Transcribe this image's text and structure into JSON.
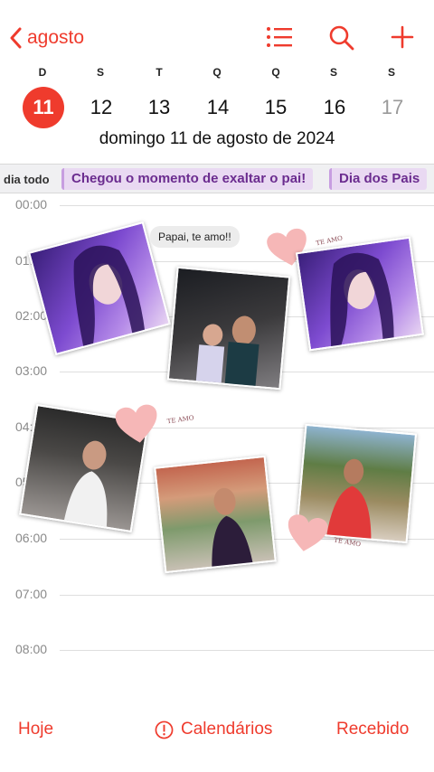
{
  "colors": {
    "accent": "#ef3b2d",
    "event_bg": "#e9d9f2",
    "event_text": "#6b2c8f"
  },
  "header": {
    "back_label": "agosto",
    "icons": [
      "chevron-left-icon",
      "list-icon",
      "search-icon",
      "plus-icon"
    ]
  },
  "week": {
    "weekdays": [
      "D",
      "S",
      "T",
      "Q",
      "Q",
      "S",
      "S"
    ],
    "days": [
      "11",
      "12",
      "13",
      "14",
      "15",
      "16",
      "17"
    ],
    "selected_index": 0,
    "date_title": "domingo  11 de agosto de 2024"
  },
  "allday": {
    "label": "dia todo",
    "events": [
      "Chegou o momento de exaltar o pai!",
      "Dia dos Pais"
    ]
  },
  "timeline": {
    "hours": [
      "00:00",
      "01:00",
      "02:00",
      "03:00",
      "04:00",
      "05:00",
      "06:00",
      "07:00",
      "08:00"
    ]
  },
  "overlay": {
    "bubble_text": "Papai, te amo!!",
    "heart_text": "TE AMO"
  },
  "toolbar": {
    "today": "Hoje",
    "calendars": "Calendários",
    "inbox": "Recebido"
  }
}
